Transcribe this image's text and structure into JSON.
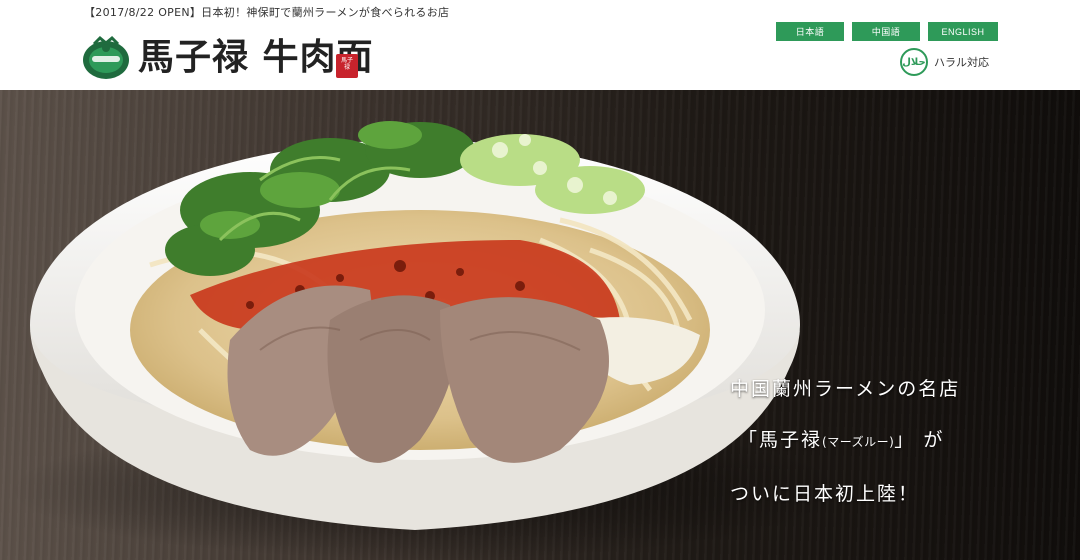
{
  "announcement": "【2017/8/22 OPEN】日本初！神保町で蘭州ラーメンが食べられるお店",
  "brand": {
    "name": "馬子禄 牛肉面",
    "seal_text": "馬子禄"
  },
  "languages": [
    {
      "label": "日本語"
    },
    {
      "label": "中国語"
    },
    {
      "label": "ENGLISH"
    }
  ],
  "halal": {
    "icon_text": "حلال",
    "label": "ハラル対応"
  },
  "hero": {
    "line1": "中国蘭州ラーメンの名店",
    "line2_main": "「馬子禄",
    "line2_reading": "(マーズルー)",
    "line2_end": "」 が",
    "line3": "ついに日本初上陸！"
  },
  "colors": {
    "accent_green": "#2e9a59",
    "seal_red": "#c8232c"
  }
}
